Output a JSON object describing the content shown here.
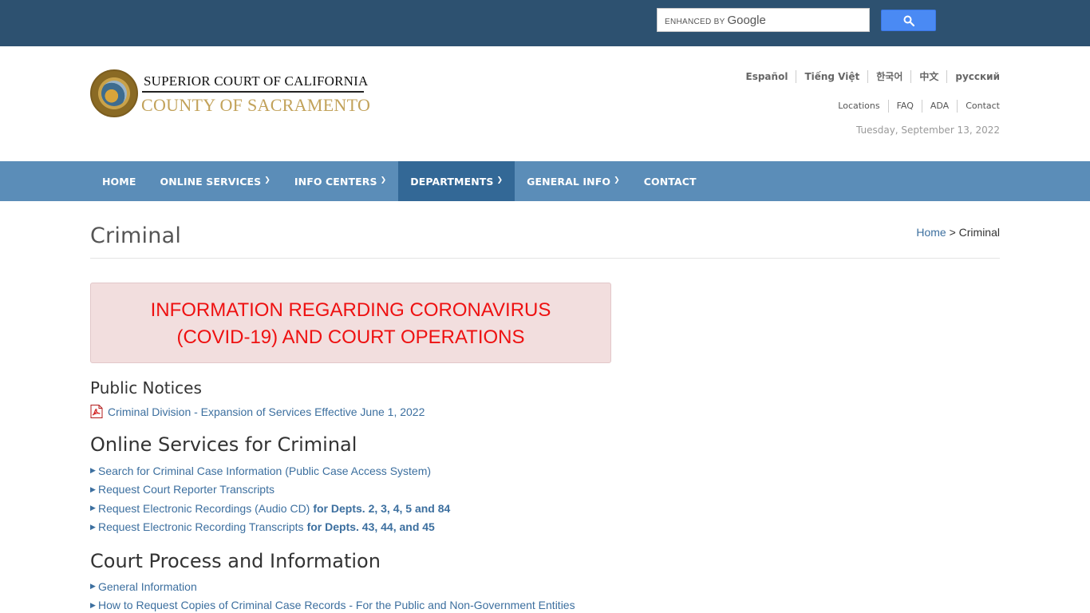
{
  "search": {
    "watermark_prefix": "ENHANCED BY",
    "watermark_brand": "Google",
    "button_icon": "search-icon"
  },
  "header": {
    "court_line1": "SUPERIOR COURT OF CALIFORNIA",
    "court_line2": "COUNTY OF SACRAMENTO",
    "languages": [
      "Español",
      "Tiếng Việt",
      "한국어",
      "中文",
      "русский"
    ],
    "utility_links": [
      "Locations",
      "FAQ",
      "ADA",
      "Contact"
    ],
    "date": "Tuesday, September 13, 2022"
  },
  "nav": {
    "items": [
      {
        "label": "HOME",
        "dropdown": false
      },
      {
        "label": "ONLINE SERVICES",
        "dropdown": true
      },
      {
        "label": "INFO CENTERS",
        "dropdown": true
      },
      {
        "label": "DEPARTMENTS",
        "dropdown": true,
        "active": true
      },
      {
        "label": "GENERAL INFO",
        "dropdown": true
      },
      {
        "label": "CONTACT",
        "dropdown": false
      }
    ]
  },
  "page": {
    "title": "Criminal",
    "breadcrumb_home": "Home",
    "breadcrumb_sep": ">",
    "breadcrumb_current": "Criminal"
  },
  "alert": {
    "line1": "INFORMATION REGARDING CORONAVIRUS",
    "line2": "(COVID-19) AND COURT OPERATIONS"
  },
  "public_notices": {
    "heading": "Public Notices",
    "items": [
      {
        "label": "Criminal Division - Expansion of Services Effective June 1, 2022",
        "icon": "pdf-icon"
      }
    ]
  },
  "online_services": {
    "heading": "Online Services for Criminal",
    "items": [
      {
        "label": "Search for Criminal Case Information (Public Case Access System)",
        "suffix": ""
      },
      {
        "label": "Request Court Reporter Transcripts",
        "suffix": ""
      },
      {
        "label": "Request Electronic Recordings (Audio CD)",
        "suffix": "for Depts. 2, 3, 4, 5 and 84"
      },
      {
        "label": "Request Electronic Recording Transcripts",
        "suffix": "for Depts. 43, 44, and 45"
      }
    ]
  },
  "court_process": {
    "heading": "Court Process and Information",
    "items": [
      {
        "label": "General Information"
      },
      {
        "label": "How to Request Copies of Criminal Case Records - For the Public and Non-Government Entities"
      }
    ]
  },
  "colors": {
    "topbar": "#2d5170",
    "nav": "#5b8db8",
    "nav_active": "#336896",
    "link": "#3c6f9f",
    "alert_bg": "#f2dede",
    "alert_text": "#ee1111",
    "court_gold": "#c2a25a"
  }
}
